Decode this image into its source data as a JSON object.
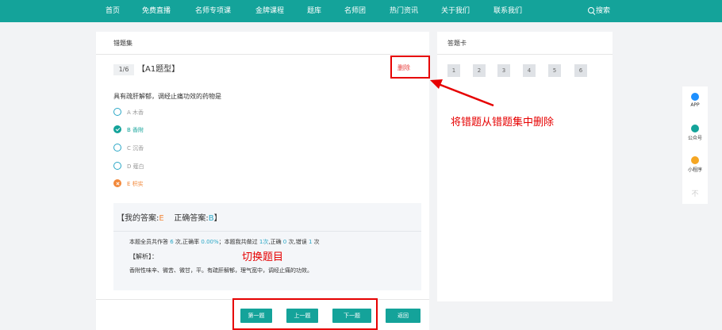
{
  "nav": {
    "items": [
      "首页",
      "免费直播",
      "名师专项课",
      "金牌课程",
      "题库",
      "名师团",
      "热门资讯",
      "关于我们",
      "联系我们"
    ],
    "search_label": "搜索"
  },
  "left_panel": {
    "title": "错题集",
    "question_index": "1/6",
    "question_type": "【A1题型】",
    "delete_label": "删除",
    "stem": "具有疏肝解郁，调经止痛功效的药物是",
    "options": [
      {
        "label": "A 木香",
        "state": "none"
      },
      {
        "label": "B 香附",
        "state": "correct"
      },
      {
        "label": "C 沉香",
        "state": "none"
      },
      {
        "label": "D 薤白",
        "state": "none"
      },
      {
        "label": "E 枳实",
        "state": "wrong"
      }
    ],
    "my_answer_prefix": "【我的答案:",
    "my_answer": "E",
    "correct_answer_prefix": "正确答案:",
    "correct_answer": "B",
    "answer_suffix": "】",
    "stats": {
      "p1": "本题全员共作答 ",
      "total": "6",
      "p2": " 次,正确率 ",
      "rate": "0.00%",
      "p3": "；本题我共做过 ",
      "mine": "1次",
      "p4": ",正确 ",
      "right": "0",
      "p5": " 次,错误 ",
      "wrong": "1",
      "p6": " 次"
    },
    "analysis_label": "【解析】：",
    "analysis_text": "香附性味辛、微苦、微甘，平。有疏肝解郁，理气宽中，调经止痛的功效。",
    "buttons": {
      "first": "第一题",
      "prev": "上一题",
      "next": "下一题",
      "back": "返回"
    }
  },
  "right_panel": {
    "title": "答题卡",
    "numbers": [
      "1",
      "2",
      "3",
      "4",
      "5",
      "6"
    ]
  },
  "annotations": {
    "delete_note": "将错题从错题集中删除",
    "switch_note": "切换题目"
  },
  "side": {
    "items": [
      {
        "label": "APP",
        "color": "#1e90ff"
      },
      {
        "label": "公众号",
        "color": "#14a39a"
      },
      {
        "label": "小程序",
        "color": "#f5a623"
      }
    ],
    "close": "不"
  },
  "colors": {
    "brand": "#14a39a",
    "correct": "#14a39a",
    "wrong": "#f2883a",
    "annotation": "#e60000",
    "link": "#2aa7c6"
  }
}
